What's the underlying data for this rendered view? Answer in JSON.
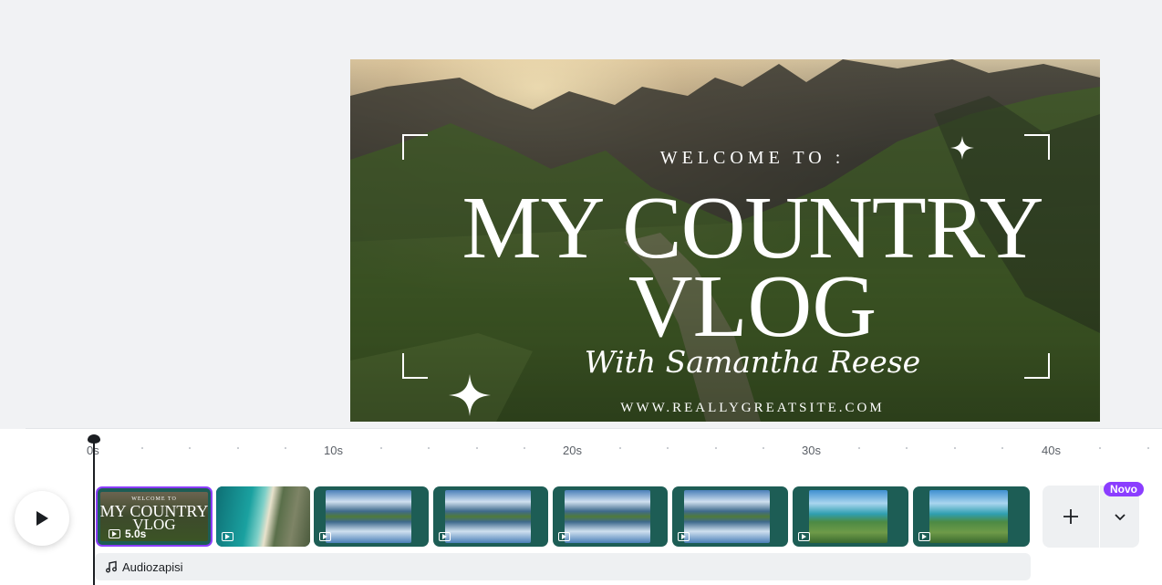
{
  "slide": {
    "welcome": "WELCOME TO :",
    "title_line1": "MY COUNTRY",
    "title_line2": "VLOG",
    "script_line": "With Samantha Reese",
    "website": "WWW.REALLYGREATSITE.COM"
  },
  "timeline": {
    "ruler": [
      "0s",
      "10s",
      "20s",
      "30s",
      "40s"
    ],
    "first_clip": {
      "mini_welcome": "WELCOME TO",
      "mini_title1": "MY COUNTRY",
      "mini_title2": "VLOG",
      "duration": "5.0s"
    },
    "new_badge": "Novo",
    "audio_label": "Audiozapisi"
  },
  "colors": {
    "accent": "#8b3dff",
    "clip_bg": "#1d5d55",
    "canvas_bg": "#f1f2f4"
  },
  "icons": [
    "play-icon",
    "video-icon",
    "plus-icon",
    "chevron-down-icon",
    "music-note-icon",
    "sparkle-icon"
  ]
}
